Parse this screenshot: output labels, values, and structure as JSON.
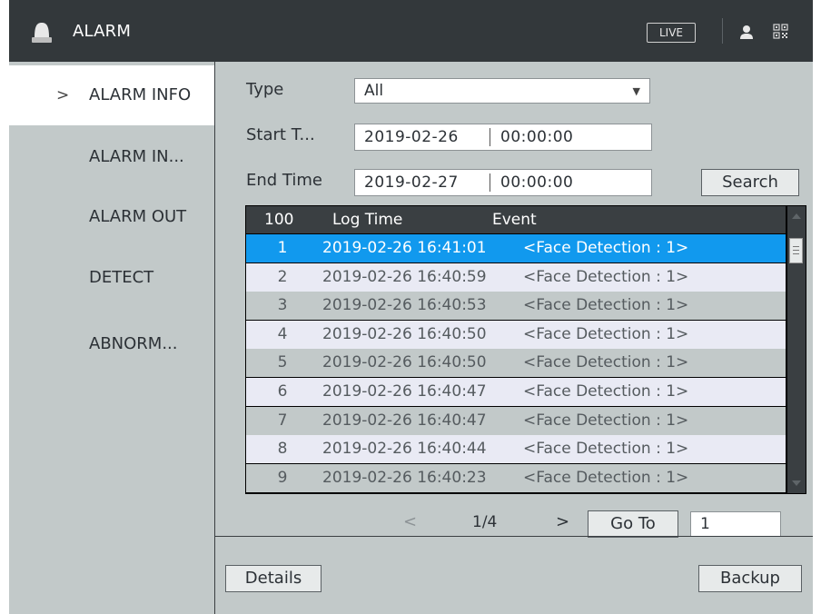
{
  "header": {
    "title": "ALARM",
    "live_label": "LIVE",
    "icons": [
      "alarm-bell-icon",
      "user-icon",
      "qr-code-icon"
    ]
  },
  "sidebar": {
    "items": [
      {
        "label": "ALARM INFO",
        "active": true
      },
      {
        "label": "ALARM IN..."
      },
      {
        "label": "ALARM OUT"
      },
      {
        "label": "DETECT"
      },
      {
        "label": "ABNORM..."
      }
    ],
    "active_marker": ">"
  },
  "filters": {
    "type_label": "Type",
    "type_value": "All",
    "start_label": "Start T...",
    "start_date": "2019-02-26",
    "start_time": "00:00:00",
    "end_label": "End Time",
    "end_date": "2019-02-27",
    "end_time": "00:00:00",
    "search_label": "Search"
  },
  "table": {
    "headers": {
      "count": "100",
      "log_time": "Log Time",
      "event": "Event"
    },
    "rows": [
      {
        "n": "1",
        "time": "2019-02-26 16:41:01",
        "event": "<Face Detection : 1>"
      },
      {
        "n": "2",
        "time": "2019-02-26 16:40:59",
        "event": "<Face Detection : 1>"
      },
      {
        "n": "3",
        "time": "2019-02-26 16:40:53",
        "event": "<Face Detection : 1>"
      },
      {
        "n": "4",
        "time": "2019-02-26 16:40:50",
        "event": "<Face Detection : 1>"
      },
      {
        "n": "5",
        "time": "2019-02-26 16:40:50",
        "event": "<Face Detection : 1>"
      },
      {
        "n": "6",
        "time": "2019-02-26 16:40:47",
        "event": "<Face Detection : 1>"
      },
      {
        "n": "7",
        "time": "2019-02-26 16:40:47",
        "event": "<Face Detection : 1>"
      },
      {
        "n": "8",
        "time": "2019-02-26 16:40:44",
        "event": "<Face Detection : 1>"
      },
      {
        "n": "9",
        "time": "2019-02-26 16:40:23",
        "event": "<Face Detection : 1>"
      }
    ],
    "selected_row": "1"
  },
  "pager": {
    "prev": "<",
    "page": "1/4",
    "next": ">",
    "goto_label": "Go To",
    "goto_value": "1"
  },
  "footer": {
    "details_label": "Details",
    "backup_label": "Backup"
  },
  "colors": {
    "header_bg": "#33383b",
    "panel_bg": "#c2c9c9",
    "selected_row": "#1199ee",
    "even_row": "#e9eaf4"
  }
}
